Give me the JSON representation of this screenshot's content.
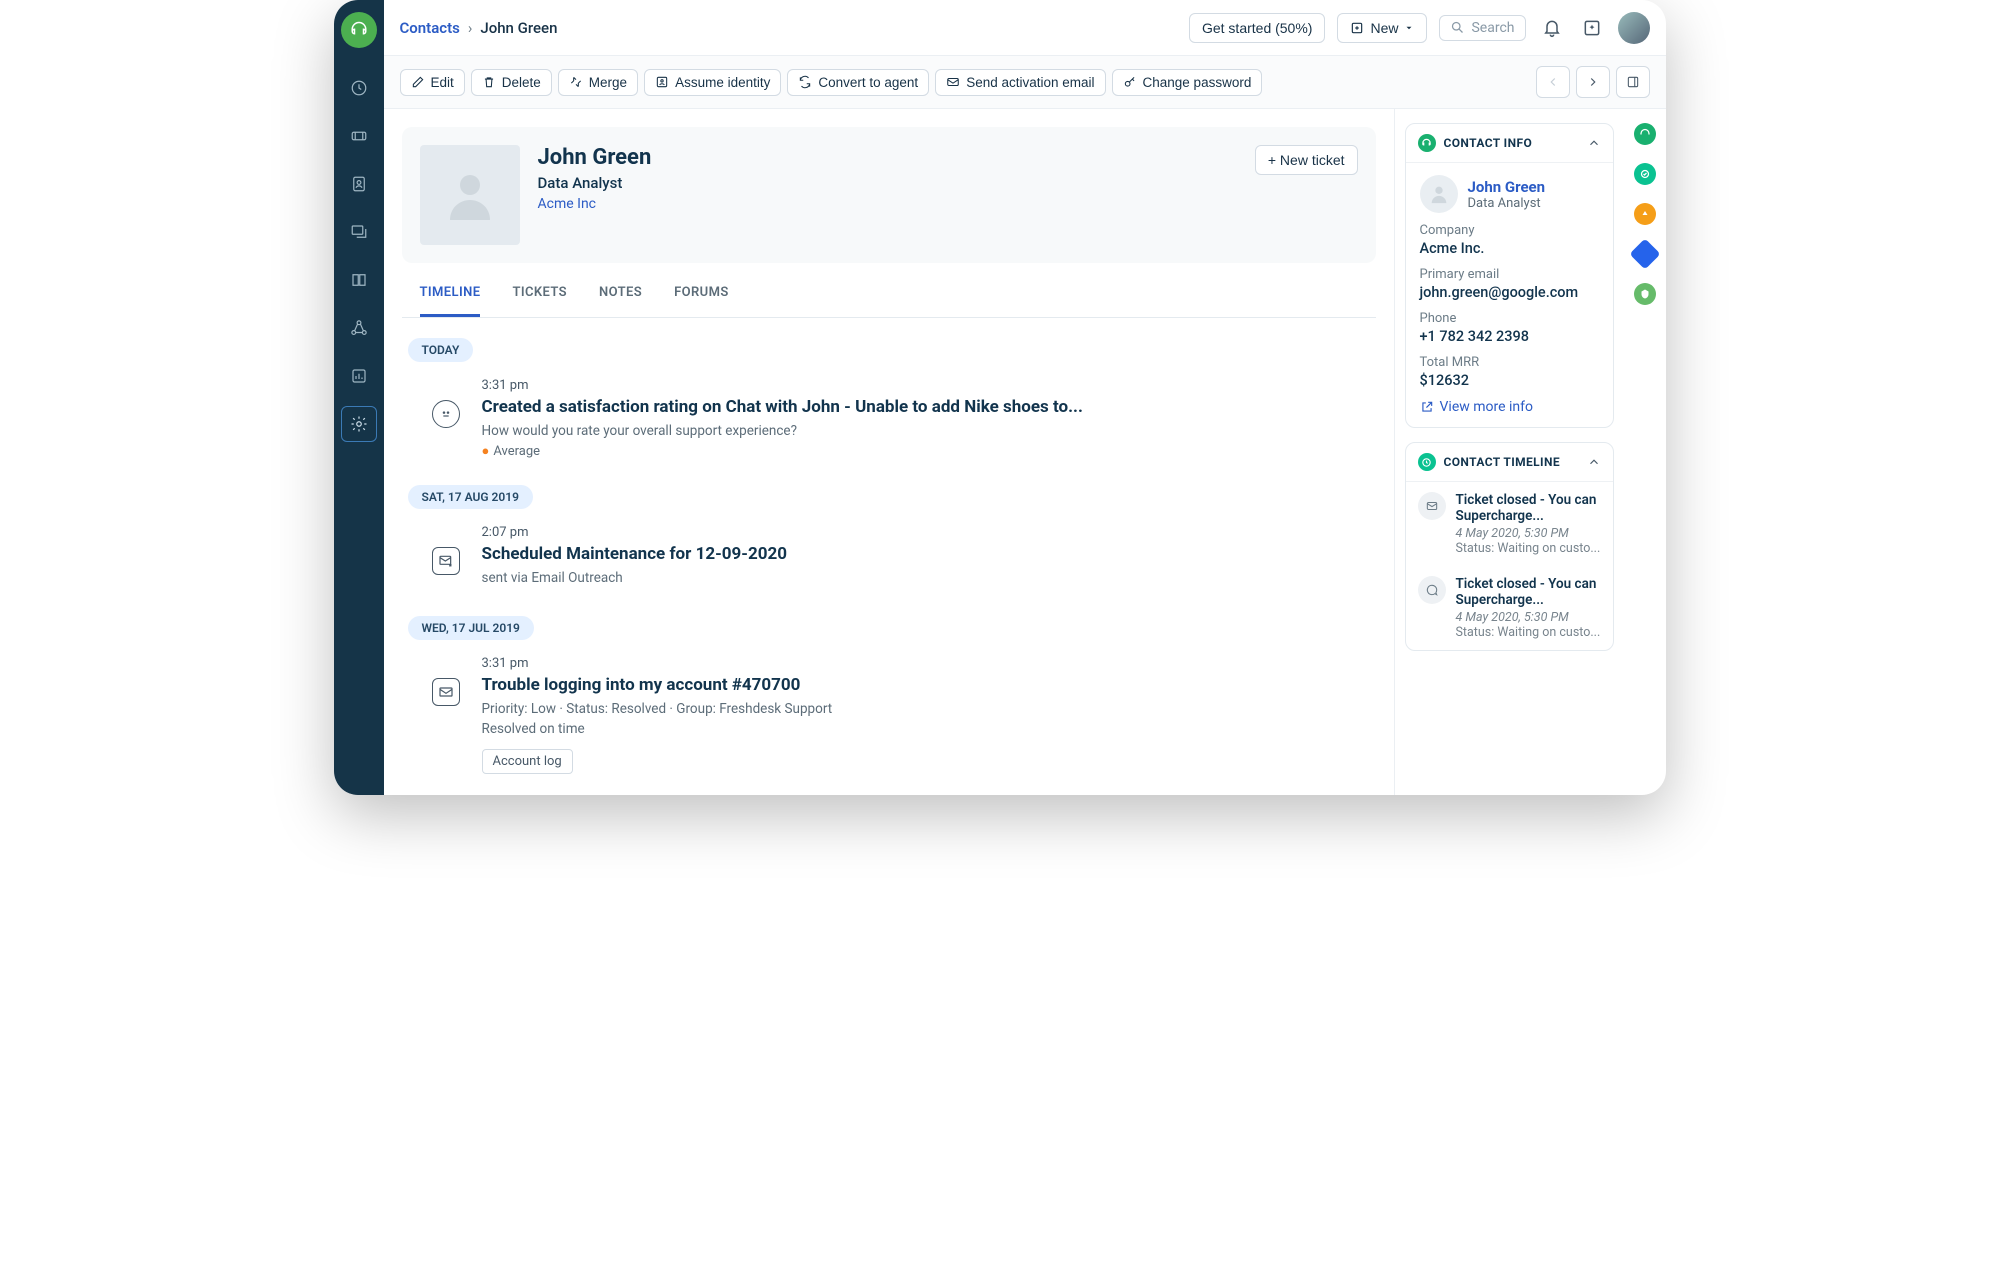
{
  "breadcrumb": {
    "root": "Contacts",
    "current": "John Green"
  },
  "header": {
    "get_started": "Get started (50%)",
    "new_btn": "New",
    "search_placeholder": "Search"
  },
  "toolbar": {
    "edit": "Edit",
    "delete": "Delete",
    "merge": "Merge",
    "assume": "Assume identity",
    "convert": "Convert to agent",
    "send_activation": "Send activation email",
    "change_password": "Change password"
  },
  "profile": {
    "name": "John Green",
    "role": "Data Analyst",
    "company": "Acme Inc",
    "new_ticket": "+ New ticket"
  },
  "tabs": {
    "timeline": "TIMELINE",
    "tickets": "TICKETS",
    "notes": "NOTES",
    "forums": "FORUMS"
  },
  "timeline": {
    "today_label": "TODAY",
    "item1": {
      "time": "3:31 pm",
      "title": "Created a satisfaction rating on Chat with John - Unable to add Nike shoes to...",
      "sub": "How would you rate your overall support experience?",
      "rating": "Average"
    },
    "date2": "SAT, 17 AUG 2019",
    "item2": {
      "time": "2:07 pm",
      "title": "Scheduled Maintenance for 12-09-2020",
      "sub": "sent via Email Outreach"
    },
    "date3": "WED, 17 JUL 2019",
    "item3": {
      "time": "3:31 pm",
      "title": "Trouble logging into my account #470700",
      "meta": "Priority: Low   ·   Status: Resolved   ·   Group: Freshdesk Support",
      "resolved": "Resolved on time",
      "badge": "Account log"
    }
  },
  "contact_info": {
    "title": "CONTACT INFO",
    "name": "John Green",
    "role": "Data Analyst",
    "company_label": "Company",
    "company": "Acme Inc.",
    "email_label": "Primary email",
    "email": "john.green@google.com",
    "phone_label": "Phone",
    "phone": "+1 782 342 2398",
    "mrr_label": "Total MRR",
    "mrr": "$12632",
    "view_more": "View more info"
  },
  "contact_timeline": {
    "title": "CONTACT TIMELINE",
    "item1": {
      "title": "Ticket closed - You can Supercharge...",
      "date": "4 May 2020, 5:30 PM",
      "status": "Status: Waiting on custo..."
    },
    "item2": {
      "title": "Ticket closed - You can Supercharge...",
      "date": "4 May 2020, 5:30 PM",
      "status": "Status: Waiting on custo..."
    }
  }
}
